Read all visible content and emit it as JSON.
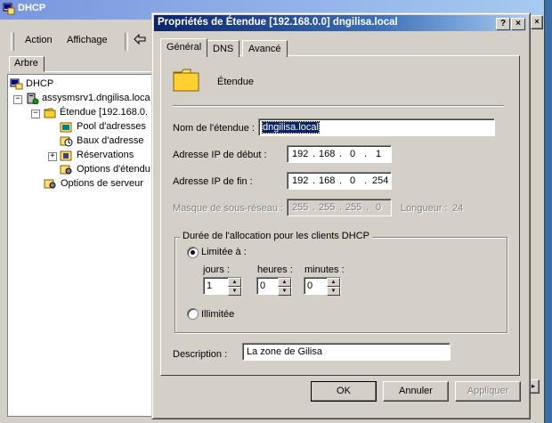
{
  "bg_window": {
    "title": "DHCP",
    "menu": {
      "action": "Action",
      "view": "Affichage"
    },
    "tree_tab": "Arbre",
    "tree": {
      "root": "DHCP",
      "server": "assysmsrv1.dngilisa.loca",
      "scope": "Étendue [192.168.0.",
      "pool": "Pool d'adresses",
      "leases": "Baux d'adresse",
      "reservations": "Réservations",
      "scope_options": "Options d'étendu",
      "server_options": "Options de serveur"
    }
  },
  "dialog": {
    "title": "Propriétés de Étendue [192.168.0.0] dngilisa.local",
    "help_btn": "?",
    "close_btn": "×",
    "tabs": [
      "Général",
      "DNS",
      "Avancé"
    ],
    "header_label": "Étendue",
    "scope_name_label": "Nom de l'étendue :",
    "scope_name_value": "dngilisa.local",
    "start_ip_label": "Adresse IP de début :",
    "start_ip": [
      "192",
      "168",
      "0",
      "1"
    ],
    "end_ip_label": "Adresse IP de fin :",
    "end_ip": [
      "192",
      "168",
      "0",
      "254"
    ],
    "mask_label": "Masque de sous-réseau :",
    "mask": [
      "255",
      "255",
      "255",
      "0"
    ],
    "length_label": "Longueur :",
    "length_value": "24",
    "lease_group_label": "Durée de l'allocation pour les clients DHCP",
    "limited_label": "Limitée à :",
    "days_label": "jours :",
    "days_value": "1",
    "hours_label": "heures :",
    "hours_value": "0",
    "minutes_label": "minutes :",
    "minutes_value": "0",
    "unlimited_label": "Illimitée",
    "description_label": "Description :",
    "description_value": "La zone de Gilisa",
    "ok": "OK",
    "cancel": "Annuler",
    "apply": "Appliquer"
  },
  "colors": {
    "desktop": "#3a6ea5",
    "face": "#d4d0c8",
    "title_active": "#0a246a",
    "selection": "#0a246a"
  }
}
